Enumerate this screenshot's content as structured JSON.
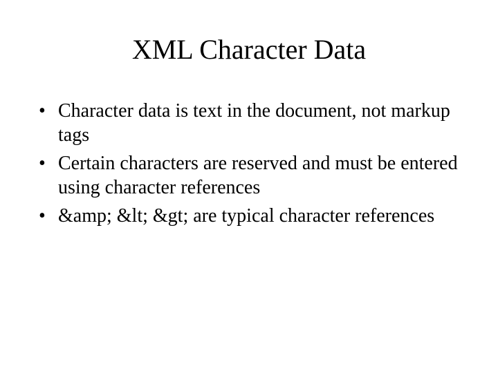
{
  "slide": {
    "title": "XML Character Data",
    "bullets": [
      "Character data is text in the document, not markup tags",
      "Certain characters are reserved and must be entered using character references",
      "&amp; &lt; &gt; are typical character references"
    ]
  }
}
